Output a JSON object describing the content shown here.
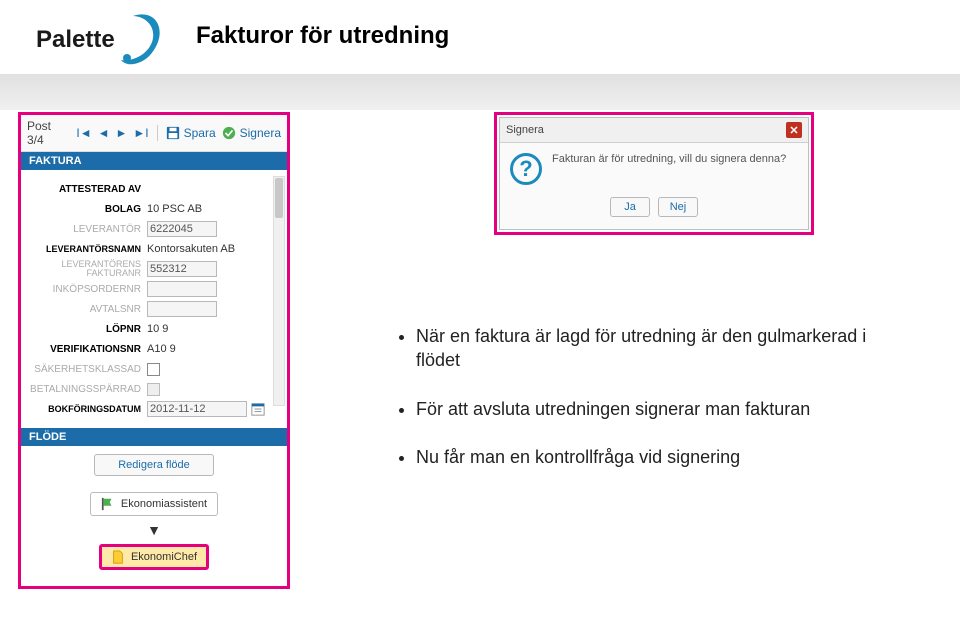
{
  "logo_text": "Palette",
  "page_title": "Fakturor för utredning",
  "toolbar": {
    "post_counter": "Post 3/4",
    "spara": "Spara",
    "signera": "Signera"
  },
  "sections": {
    "faktura": "FAKTURA",
    "flode": "FLÖDE"
  },
  "form": {
    "attesterad_av": {
      "label": "ATTESTERAD AV",
      "value": ""
    },
    "bolag": {
      "label": "BOLAG",
      "value": "10 PSC AB"
    },
    "leverantor": {
      "label": "LEVERANTÖR",
      "value": "6222045"
    },
    "leverantorsnamn": {
      "label": "LEVERANTÖRSNAMN",
      "value": "Kontorsakuten AB"
    },
    "leverantorens_fakturanr": {
      "label": "LEVERANTÖRENS FAKTURANR",
      "value": "552312"
    },
    "inkopsordernr": {
      "label": "INKÖPSORDERNR",
      "value": ""
    },
    "avtalsnr": {
      "label": "AVTALSNR",
      "value": ""
    },
    "lopnr": {
      "label": "LÖPNR",
      "value": "10 9"
    },
    "verifikationsnr": {
      "label": "VERIFIKATIONSNR",
      "value": "A10 9"
    },
    "sakerhetsklassad": {
      "label": "SÄKERHETSKLASSAD",
      "checked": false
    },
    "betalningssparrad": {
      "label": "BETALNINGSSPÄRRAD",
      "checked": false
    },
    "bokforingsdatum": {
      "label": "BOKFÖRINGSDATUM",
      "value": "2012-11-12"
    }
  },
  "redigera_flode": "Redigera flöde",
  "flow": {
    "step1": "Ekonomiassistent",
    "step2": "EkonomiChef"
  },
  "dialog": {
    "title": "Signera",
    "message": "Fakturan är för utredning, vill du signera denna?",
    "yes": "Ja",
    "no": "Nej"
  },
  "bullets": {
    "b1": "När en faktura är lagd för utredning är den gulmarkerad i flödet",
    "b2": "För att avsluta utredningen signerar man fakturan",
    "b3": "Nu får man en kontrollfråga vid signering"
  }
}
